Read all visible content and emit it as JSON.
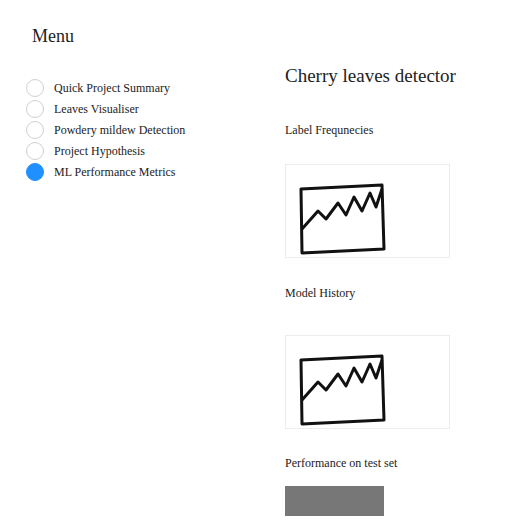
{
  "sidebar": {
    "title": "Menu",
    "items": [
      {
        "label": "Quick Project Summary",
        "selected": false
      },
      {
        "label": "Leaves Visualiser",
        "selected": false
      },
      {
        "label": "Powdery mildew Detection",
        "selected": false
      },
      {
        "label": "Project Hypothesis",
        "selected": false
      },
      {
        "label": "ML Performance Metrics",
        "selected": true
      }
    ]
  },
  "main": {
    "title": "Cherry leaves detector",
    "sections": [
      {
        "label": "Label Frequnecies",
        "kind": "image"
      },
      {
        "label": "Model History",
        "kind": "image"
      },
      {
        "label": "Performance on test set",
        "kind": "table"
      }
    ]
  }
}
